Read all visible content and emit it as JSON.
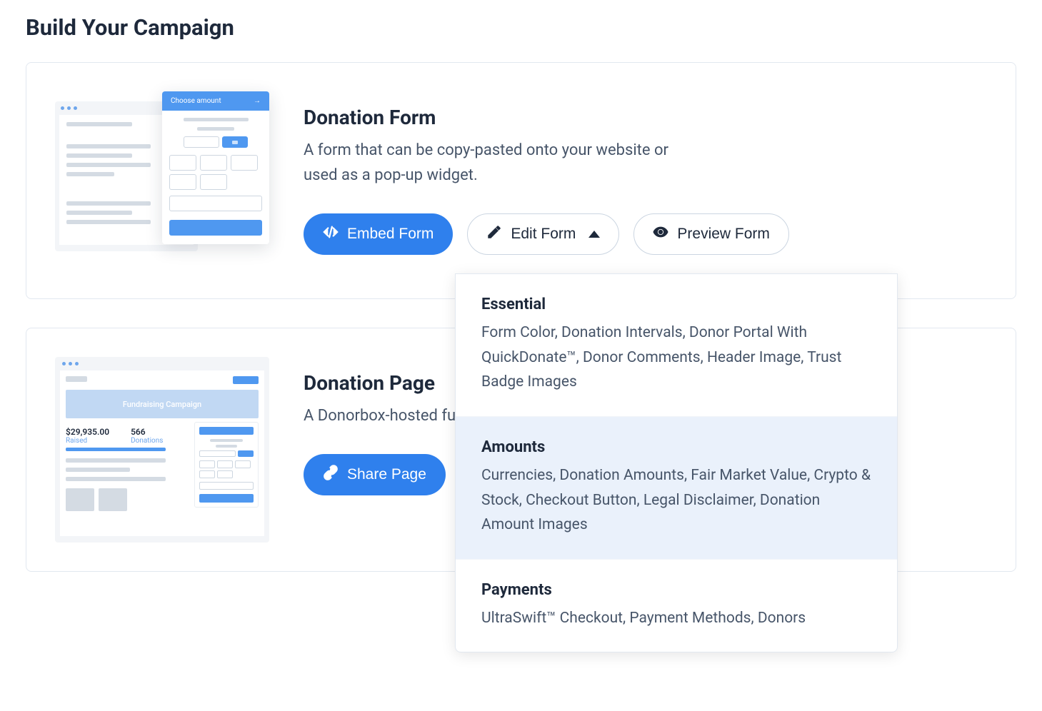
{
  "page_title": "Build Your Campaign",
  "cards": {
    "donation_form": {
      "title": "Donation Form",
      "description": "A form that can be copy-pasted onto your website or used as a pop-up widget.",
      "thumbnail": {
        "popup_header": "Choose amount"
      },
      "buttons": {
        "embed": "Embed Form",
        "edit": "Edit Form",
        "preview": "Preview Form"
      },
      "edit_dropdown": [
        {
          "title": "Essential",
          "description": "Form Color, Donation Intervals, Donor Portal With QuickDonate™, Donor Comments, Header Image, Trust Badge Images",
          "highlighted": false
        },
        {
          "title": "Amounts",
          "description": "Currencies, Donation Amounts, Fair Market Value, Crypto & Stock, Checkout Button, Legal Disclaimer, Donation Amount Images",
          "highlighted": true
        },
        {
          "title": "Payments",
          "description": "UltraSwift™ Checkout, Payment Methods, Donors",
          "highlighted": false
        }
      ]
    },
    "donation_page": {
      "title": "Donation Page",
      "description": "A Donorbox-hosted fu with a donation form a",
      "thumbnail": {
        "hero_text": "Fundraising Campaign",
        "stats": {
          "raised_value": "$29,935.00",
          "raised_label": "Raised",
          "donations_value": "566",
          "donations_label": "Donations"
        }
      },
      "buttons": {
        "share": "Share Page"
      }
    }
  }
}
